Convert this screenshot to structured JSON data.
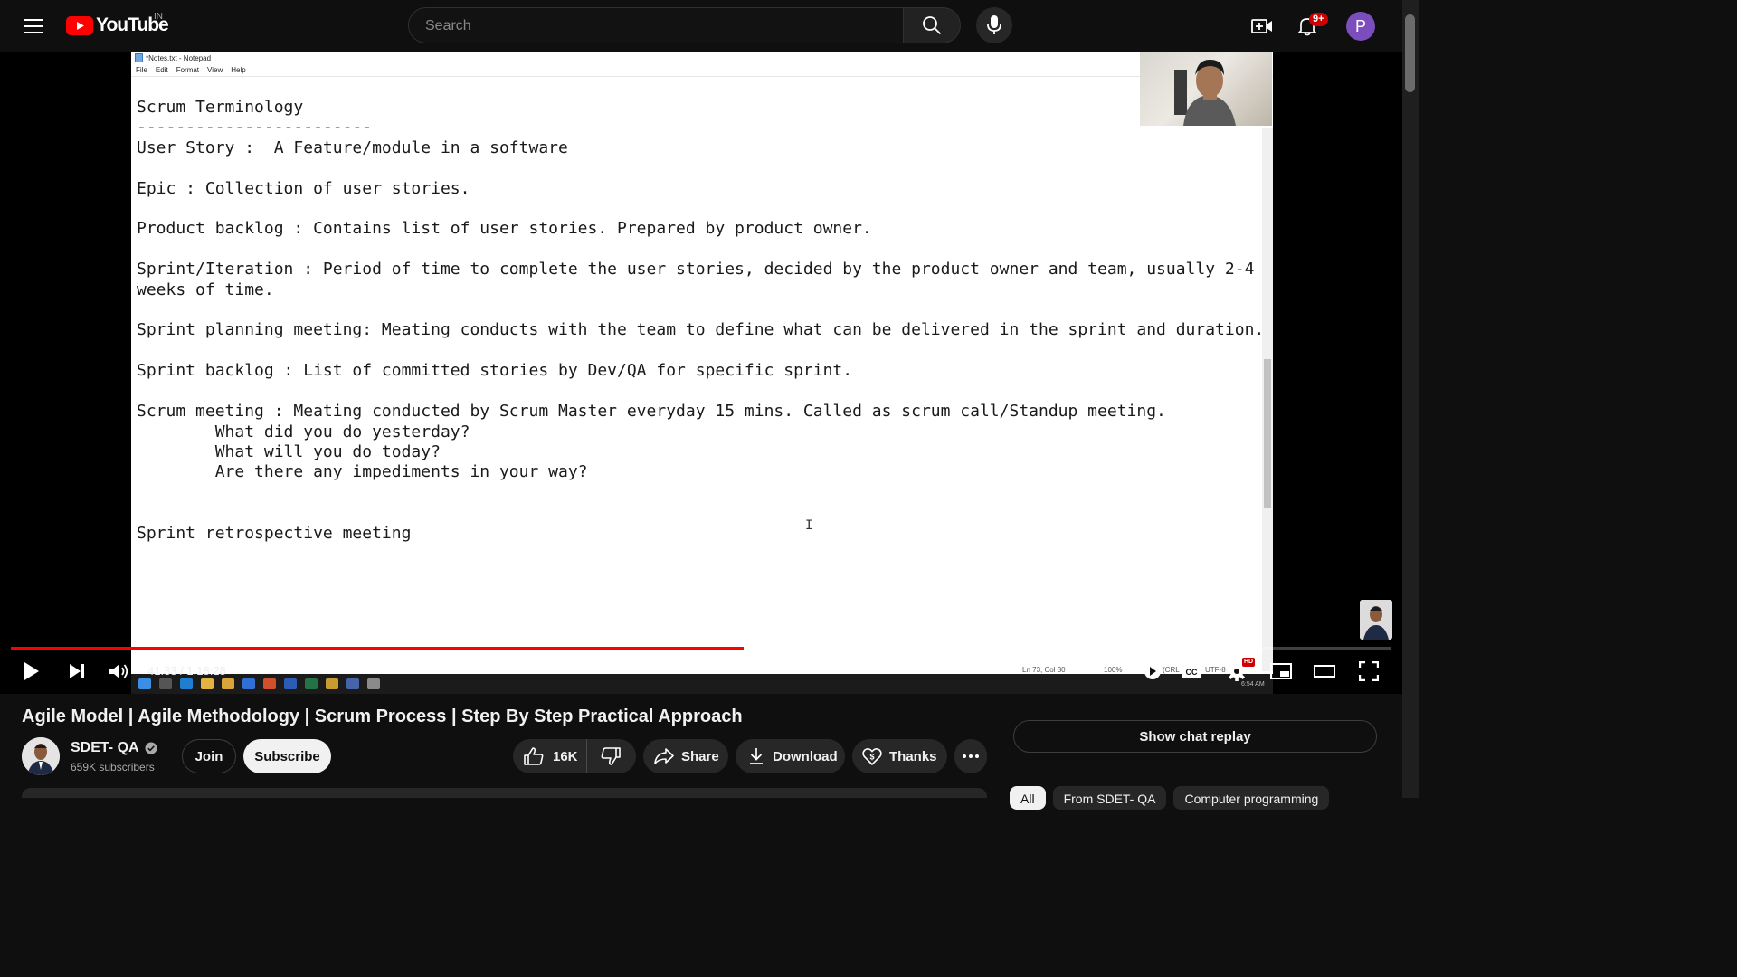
{
  "header": {
    "logo_text": "YouTube",
    "region": "IN",
    "search_placeholder": "Search",
    "notification_count": "9+",
    "avatar_initial": "P"
  },
  "notepad": {
    "window_title": "*Notes.txt - Notepad",
    "menu": [
      "File",
      "Edit",
      "Format",
      "View",
      "Help"
    ],
    "content": "Scrum Terminology\n------------------------\nUser Story :  A Feature/module in a software\n\nEpic : Collection of user stories.\n\nProduct backlog : Contains list of user stories. Prepared by product owner.\n\nSprint/Iteration : Period of time to complete the user stories, decided by the product owner and team, usually 2-4\nweeks of time.\n\nSprint planning meeting: Meating conducts with the team to define what can be delivered in the sprint and duration.\n\nSprint backlog : List of committed stories by Dev/QA for specific sprint.\n\nScrum meeting : Meating conducted by Scrum Master everyday 15 mins. Called as scrum call/Standup meeting.\n        What did you do yesterday?\n        What will you do today?\n        Are there any impediments in your way?\n\n\nSprint retrospective meeting",
    "status_position": "Ln 73, Col 30",
    "status_zoom": "100%",
    "status_eol": "(CRL",
    "status_encoding": "UTF-8",
    "clock": "6:54 AM"
  },
  "player": {
    "time_current": "41:33",
    "time_total": "1:18:28",
    "progress_fraction": 0.531,
    "buffered_fraction": 0.559,
    "quality_badge": "HD"
  },
  "video": {
    "title": "Agile Model | Agile Methodology | Scrum Process | Step By Step Practical Approach",
    "channel_name": "SDET- QA",
    "subscribers": "659K subscribers",
    "join_label": "Join",
    "subscribe_label": "Subscribe",
    "like_count": "16K",
    "share_label": "Share",
    "download_label": "Download",
    "thanks_label": "Thanks"
  },
  "sidebar": {
    "chat_replay_label": "Show chat replay",
    "chips": [
      "All",
      "From SDET- QA",
      "Computer programming"
    ]
  },
  "colors": {
    "accent": "#ff0000",
    "background": "#0f0f0f",
    "avatar": "#7c4dbd"
  }
}
